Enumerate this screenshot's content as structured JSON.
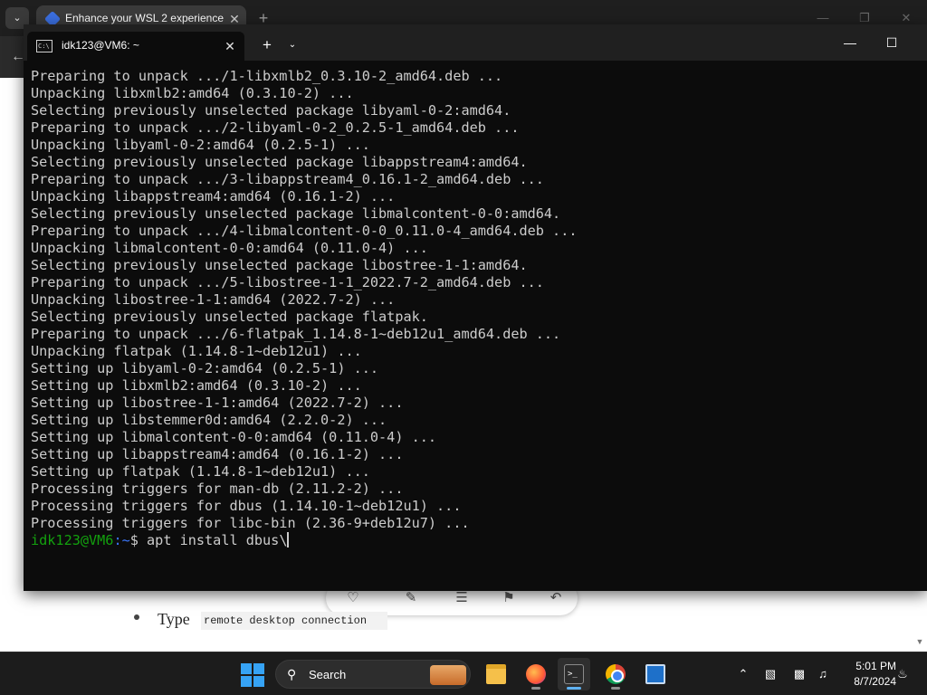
{
  "browser": {
    "tab_title": "Enhance your WSL 2 experience",
    "article": {
      "bullet_text": "Type",
      "code_text": "remote desktop connection"
    }
  },
  "terminal": {
    "tab_title": "idk123@VM6: ~",
    "output_lines": [
      "Preparing to unpack .../1-libxmlb2_0.3.10-2_amd64.deb ...",
      "Unpacking libxmlb2:amd64 (0.3.10-2) ...",
      "Selecting previously unselected package libyaml-0-2:amd64.",
      "Preparing to unpack .../2-libyaml-0-2_0.2.5-1_amd64.deb ...",
      "Unpacking libyaml-0-2:amd64 (0.2.5-1) ...",
      "Selecting previously unselected package libappstream4:amd64.",
      "Preparing to unpack .../3-libappstream4_0.16.1-2_amd64.deb ...",
      "Unpacking libappstream4:amd64 (0.16.1-2) ...",
      "Selecting previously unselected package libmalcontent-0-0:amd64.",
      "Preparing to unpack .../4-libmalcontent-0-0_0.11.0-4_amd64.deb ...",
      "Unpacking libmalcontent-0-0:amd64 (0.11.0-4) ...",
      "Selecting previously unselected package libostree-1-1:amd64.",
      "Preparing to unpack .../5-libostree-1-1_2022.7-2_amd64.deb ...",
      "Unpacking libostree-1-1:amd64 (2022.7-2) ...",
      "Selecting previously unselected package flatpak.",
      "Preparing to unpack .../6-flatpak_1.14.8-1~deb12u1_amd64.deb ...",
      "Unpacking flatpak (1.14.8-1~deb12u1) ...",
      "Setting up libyaml-0-2:amd64 (0.2.5-1) ...",
      "Setting up libxmlb2:amd64 (0.3.10-2) ...",
      "Setting up libostree-1-1:amd64 (2022.7-2) ...",
      "Setting up libstemmer0d:amd64 (2.2.0-2) ...",
      "Setting up libmalcontent-0-0:amd64 (0.11.0-4) ...",
      "Setting up libappstream4:amd64 (0.16.1-2) ...",
      "Setting up flatpak (1.14.8-1~deb12u1) ...",
      "Processing triggers for man-db (2.11.2-2) ...",
      "Processing triggers for dbus (1.14.10-1~deb12u1) ...",
      "Processing triggers for libc-bin (2.36-9+deb12u7) ..."
    ],
    "prompt": {
      "user_host": "idk123@VM6",
      "path": ":~",
      "symbol": "$ ",
      "command": "apt install dbus\\"
    }
  },
  "taskbar": {
    "search_placeholder": "Search",
    "time": "5:01 PM",
    "date": "8/7/2024"
  },
  "icons": {
    "start": "windows-start-icon",
    "file_explorer": "folder-icon",
    "firefox": "firefox-icon",
    "terminal": "terminal-icon",
    "chrome": "chrome-icon",
    "remote_desktop": "remote-desktop-icon"
  },
  "colors": {
    "terminal_bg": "#0c0c0c",
    "terminal_text": "#cccccc",
    "prompt_user": "#13a10e",
    "prompt_path": "#3b78ff",
    "taskbar_bg": "#1c1c1c"
  }
}
